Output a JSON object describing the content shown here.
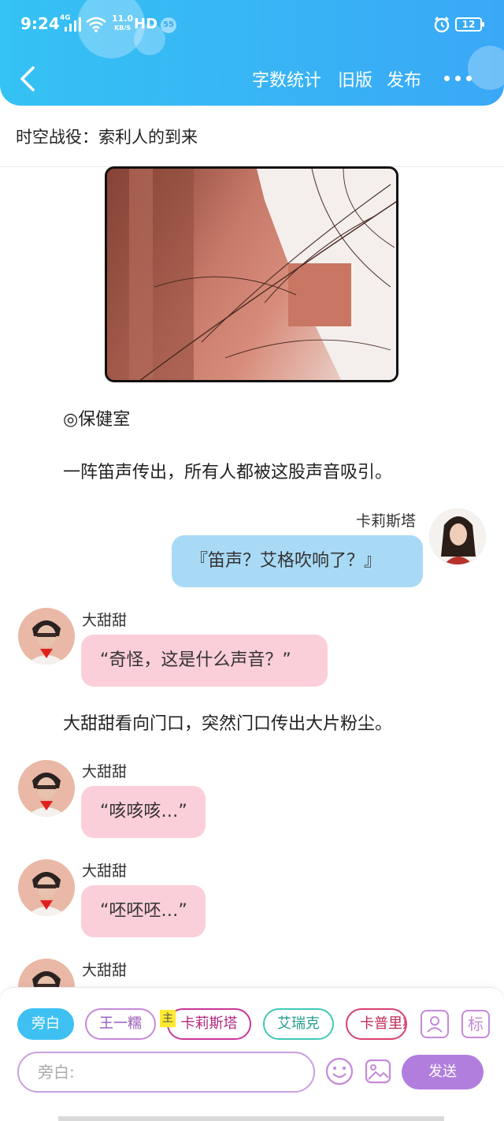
{
  "status_bar": {
    "time": "9:24",
    "network": "4G",
    "speed_value": "11.0",
    "speed_unit": "KB/S",
    "hd": "HD",
    "badge": "55",
    "battery": "12"
  },
  "header": {
    "nav": [
      "字数统计",
      "旧版",
      "发布"
    ],
    "colors": {
      "primary": "#3aa8f6",
      "light": "#35c2f4"
    }
  },
  "title": "时空战役：索利人的到来",
  "content": {
    "location": "◎保健室",
    "narration_1": "一阵笛声传出，所有人都被这股声音吸引。",
    "narration_2": "大甜甜看向门口，突然门口传出大片粉尘。",
    "messages": [
      {
        "name": "卡莉斯塔",
        "text": "『笛声？艾格吹响了？』",
        "side": "right",
        "color": "#a8daf6"
      },
      {
        "name": "大甜甜",
        "text": "“奇怪，这是什么声音？”",
        "side": "left",
        "color": "#fbcfd9"
      },
      {
        "name": "大甜甜",
        "text": "“咳咳咳…”",
        "side": "left",
        "color": "#fbcfd9"
      },
      {
        "name": "大甜甜",
        "text": "“呸呸呸…”",
        "side": "left",
        "color": "#fbcfd9"
      },
      {
        "name": "大甜甜",
        "text": "",
        "side": "left",
        "color": "#fbcfd9"
      }
    ]
  },
  "roles": {
    "items": [
      "旁白",
      "王一糯",
      "卡莉斯塔",
      "艾瑞克",
      "卡普里斯"
    ],
    "selected": "旁白",
    "host_badge": "主"
  },
  "composer": {
    "placeholder": "旁白:",
    "send_label": "发送",
    "tag_button": "标",
    "accent": "#b17edd"
  }
}
